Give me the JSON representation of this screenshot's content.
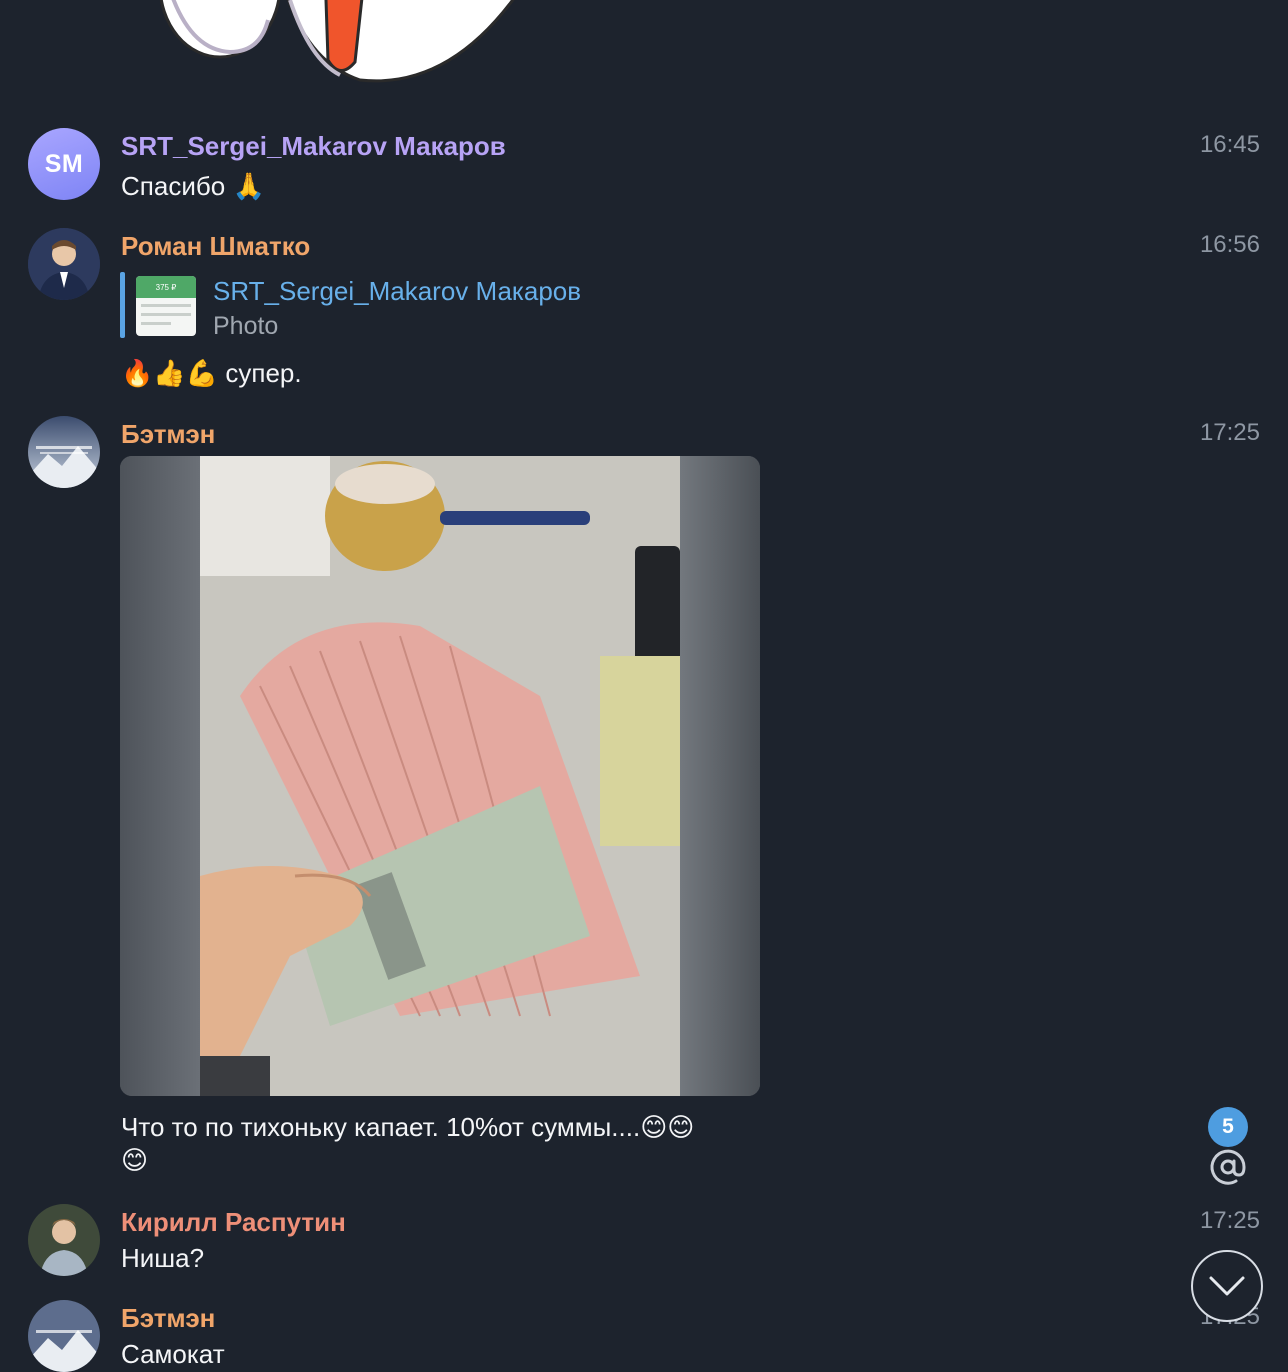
{
  "messages": [
    {
      "sender": "SRT_Sergei_Makarov Макаров",
      "initials": "SM",
      "time": "16:45",
      "text": "Спасибо",
      "emoji": "🙏",
      "sender_color": "#b7a3f5"
    },
    {
      "sender": "Роман Шматко",
      "time": "16:56",
      "reply": {
        "name": "SRT_Sergei_Makarov Макаров",
        "subtitle": "Photo",
        "thumb_amount": "375 ₽"
      },
      "emoji": "🔥👍💪",
      "text": "супер.",
      "sender_color": "#f0a56a"
    },
    {
      "sender": "Бэтмэн",
      "time": "17:25",
      "text_line1": "Что то  по тихоньку капает. 10%от суммы....",
      "emoji_line1": "😊😊",
      "emoji_line2": "😊",
      "sender_color": "#f0a56a"
    },
    {
      "sender": "Кирилл Распутин",
      "time": "17:25",
      "text": "Ниша?",
      "sender_color": "#ee8f78"
    },
    {
      "sender": "Бэтмэн",
      "time": "17:25",
      "text": "Самокат",
      "sender_color": "#f0a56a"
    }
  ],
  "unread_mentions": "5",
  "colors": {
    "background": "#1d232d",
    "accent": "#4e9de0",
    "time": "#8e97a3"
  }
}
